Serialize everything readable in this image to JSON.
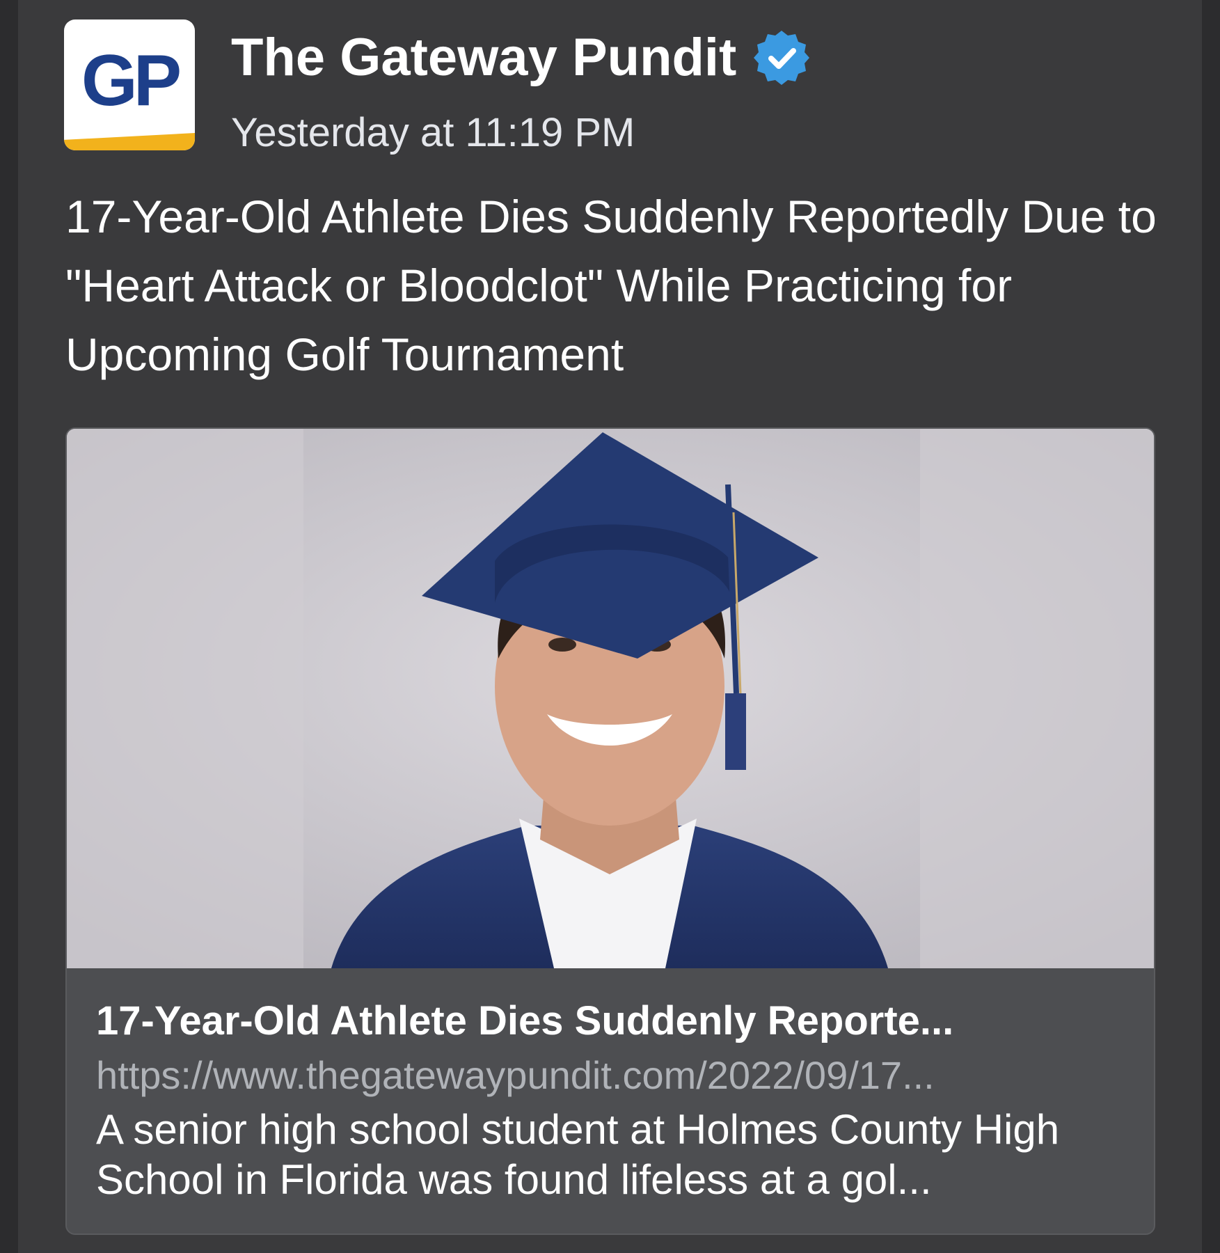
{
  "post": {
    "page_name": "The Gateway Pundit",
    "timestamp": "Yesterday at 11:19 PM",
    "avatar_text": "GP",
    "message": "17-Year-Old Athlete Dies Suddenly Reportedly Due to \"Heart Attack or Bloodclot\" While Practicing for Upcoming Golf Tournament"
  },
  "link_preview": {
    "title": "17-Year-Old Athlete Dies Suddenly Reporte...",
    "url": "https://www.thegatewaypundit.com/2022/09/17...",
    "description": "A senior high school student at Holmes County High School in Florida was found lifeless at a gol...",
    "image": "graduation-portrait-photo"
  },
  "icons": {
    "verified": "verified-badge-icon"
  },
  "colors": {
    "background": "#3a3a3c",
    "card_body": "#4d4e51",
    "verified_blue": "#3b9ae1",
    "gp_blue": "#1d3f8a",
    "gp_yellow": "#f2b21c",
    "url_gray": "#b0b3b8"
  }
}
